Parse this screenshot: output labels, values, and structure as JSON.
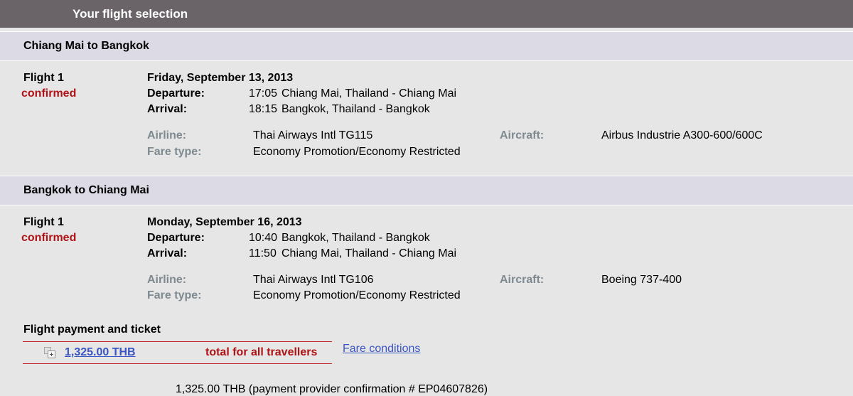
{
  "header": {
    "title": "Your flight selection"
  },
  "segments": [
    {
      "route": "Chiang Mai to Bangkok",
      "flight_label": "Flight 1",
      "status": "confirmed",
      "date": "Friday, September 13, 2013",
      "departure_label": "Departure:",
      "departure_time": "17:05",
      "departure_place": "Chiang Mai, Thailand - Chiang Mai",
      "arrival_label": "Arrival:",
      "arrival_time": "18:15",
      "arrival_place": "Bangkok, Thailand - Bangkok",
      "airline_label": "Airline:",
      "airline": "Thai Airways Intl TG115",
      "fare_type_label": "Fare type:",
      "fare_type": "Economy Promotion/Economy Restricted",
      "aircraft_label": "Aircraft:",
      "aircraft": "Airbus Industrie A300-600/600C"
    },
    {
      "route": "Bangkok to Chiang Mai",
      "flight_label": "Flight 1",
      "status": "confirmed",
      "date": "Monday, September 16, 2013",
      "departure_label": "Departure:",
      "departure_time": "10:40",
      "departure_place": "Bangkok, Thailand - Bangkok",
      "arrival_label": "Arrival:",
      "arrival_time": "11:50",
      "arrival_place": "Chiang Mai, Thailand - Chiang Mai",
      "airline_label": "Airline:",
      "airline": "Thai Airways Intl TG106",
      "fare_type_label": "Fare type:",
      "fare_type": "Economy Promotion/Economy Restricted",
      "aircraft_label": "Aircraft:",
      "aircraft": "Boeing 737-400"
    }
  ],
  "payment": {
    "heading": "Flight payment and ticket",
    "price": "1,325.00 THB",
    "total_label": "total for all travellers",
    "fare_conditions": "Fare conditions",
    "confirmation_line": "1,325.00 THB (payment provider confirmation # EP04607826)",
    "expand_icon": "expand-plus-icon"
  },
  "colors": {
    "header_bg": "#6a6468",
    "segment_bar_bg": "#dcdae5",
    "page_bg": "#e6e6e6",
    "status_red": "#b01216",
    "link_blue": "#3b56c2",
    "label_gray": "#7e8a90"
  }
}
